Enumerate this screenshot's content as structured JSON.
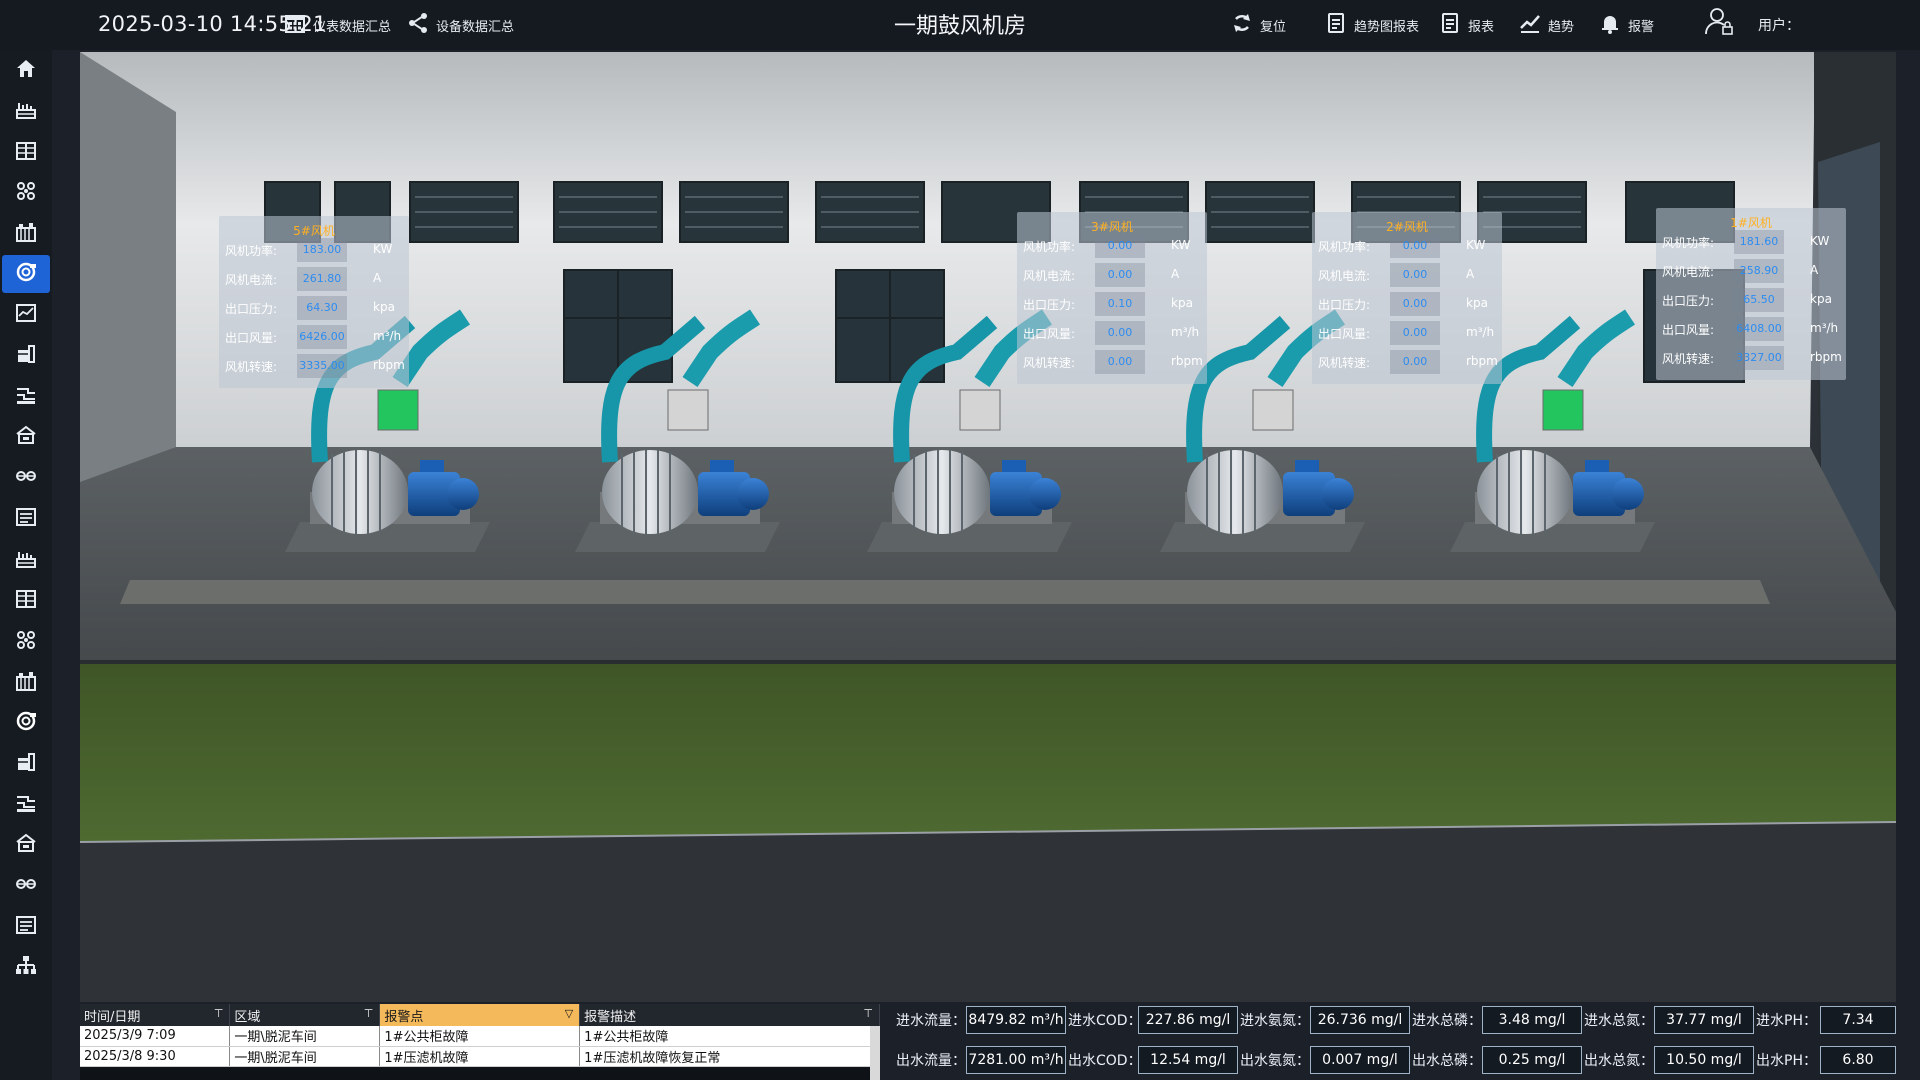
{
  "header": {
    "datetime": "2025-03-10 14:55:21",
    "title": "一期鼓风机房",
    "btn_meter_summary": "仪表数据汇总",
    "btn_device_summary": "设备数据汇总",
    "btn_reset": "复位",
    "btn_trend_report": "趋势图报表",
    "btn_report": "报表",
    "btn_trend": "趋势",
    "btn_alarm": "报警",
    "user_label": "用户："
  },
  "sidebar": {
    "items": [
      {
        "icon": "home-icon"
      },
      {
        "icon": "plant-icon"
      },
      {
        "icon": "panel-icon"
      },
      {
        "icon": "network-icon"
      },
      {
        "icon": "building-icon"
      },
      {
        "icon": "blower-icon",
        "active": true
      },
      {
        "icon": "chart-box-icon"
      },
      {
        "icon": "tank-icon"
      },
      {
        "icon": "pipeline-icon"
      },
      {
        "icon": "house-icon"
      },
      {
        "icon": "link-icon"
      },
      {
        "icon": "list-icon"
      },
      {
        "icon": "plant-icon"
      },
      {
        "icon": "panel-icon"
      },
      {
        "icon": "network-icon"
      },
      {
        "icon": "building-icon"
      },
      {
        "icon": "blower-icon"
      },
      {
        "icon": "tank-icon"
      },
      {
        "icon": "pipeline-icon"
      },
      {
        "icon": "house-icon"
      },
      {
        "icon": "link-icon"
      },
      {
        "icon": "list-icon"
      },
      {
        "icon": "org-chart-icon"
      }
    ]
  },
  "panels": [
    {
      "title": "5#风机",
      "rows": [
        {
          "label": "风机功率:",
          "value": "183.00",
          "unit": "KW"
        },
        {
          "label": "风机电流:",
          "value": "261.80",
          "unit": "A"
        },
        {
          "label": "出口压力:",
          "value": "64.30",
          "unit": "kpa"
        },
        {
          "label": "出口风量:",
          "value": "6426.00",
          "unit": "m³/h"
        },
        {
          "label": "风机转速:",
          "value": "3335.00",
          "unit": "rbpm"
        }
      ]
    },
    {
      "title": "3#风机",
      "rows": [
        {
          "label": "风机功率:",
          "value": "0.00",
          "unit": "KW"
        },
        {
          "label": "风机电流:",
          "value": "0.00",
          "unit": "A"
        },
        {
          "label": "出口压力:",
          "value": "0.10",
          "unit": "kpa"
        },
        {
          "label": "出口风量:",
          "value": "0.00",
          "unit": "m³/h"
        },
        {
          "label": "风机转速:",
          "value": "0.00",
          "unit": "rbpm"
        }
      ]
    },
    {
      "title": "2#风机",
      "rows": [
        {
          "label": "风机功率:",
          "value": "0.00",
          "unit": "KW"
        },
        {
          "label": "风机电流:",
          "value": "0.00",
          "unit": "A"
        },
        {
          "label": "出口压力:",
          "value": "0.00",
          "unit": "kpa"
        },
        {
          "label": "出口风量:",
          "value": "0.00",
          "unit": "m³/h"
        },
        {
          "label": "风机转速:",
          "value": "0.00",
          "unit": "rbpm"
        }
      ]
    },
    {
      "title": "1#风机",
      "rows": [
        {
          "label": "风机功率:",
          "value": "181.60",
          "unit": "KW"
        },
        {
          "label": "风机电流:",
          "value": "258.90",
          "unit": "A"
        },
        {
          "label": "出口压力:",
          "value": "65.50",
          "unit": "kpa"
        },
        {
          "label": "出口风量:",
          "value": "6408.00",
          "unit": "m³/h"
        },
        {
          "label": "风机转速:",
          "value": "3327.00",
          "unit": "rbpm"
        }
      ]
    }
  ],
  "alarm_table": {
    "columns": [
      "时间/日期",
      "区域",
      "报警点",
      "报警描述"
    ],
    "rows": [
      [
        "2025/3/9 7:09",
        "一期\\脱泥车间",
        "1#公共柜故障",
        "1#公共柜故障"
      ],
      [
        "2025/3/8 9:30",
        "一期\\脱泥车间",
        "1#压滤机故障",
        "1#压滤机故障恢复正常"
      ]
    ]
  },
  "metrics": {
    "inlet": [
      {
        "label": "进水流量：",
        "value": "8479.82 m³/h"
      },
      {
        "label": "进水COD：",
        "value": "227.86  mg/l"
      },
      {
        "label": "进水氨氮：",
        "value": "26.736  mg/l"
      },
      {
        "label": "进水总磷：",
        "value": "3.48  mg/l"
      },
      {
        "label": "进水总氮：",
        "value": "37.77  mg/l"
      },
      {
        "label": "进水PH：",
        "value": "7.34"
      }
    ],
    "outlet": [
      {
        "label": "出水流量：",
        "value": "7281.00 m³/h"
      },
      {
        "label": "出水COD：",
        "value": "12.54 mg/l"
      },
      {
        "label": "出水氨氮：",
        "value": "0.007  mg/l"
      },
      {
        "label": "出水总磷：",
        "value": "0.25  mg/l"
      },
      {
        "label": "出水总氮：",
        "value": "10.50  mg/l"
      },
      {
        "label": "出水PH：",
        "value": "6.80"
      }
    ]
  },
  "colors": {
    "accent": "#1f64d6",
    "panel_title": "#ffb020",
    "panel_value": "#2d8cf0",
    "running_box": "#22c55e",
    "stopped_box": "#d4d4d4"
  }
}
